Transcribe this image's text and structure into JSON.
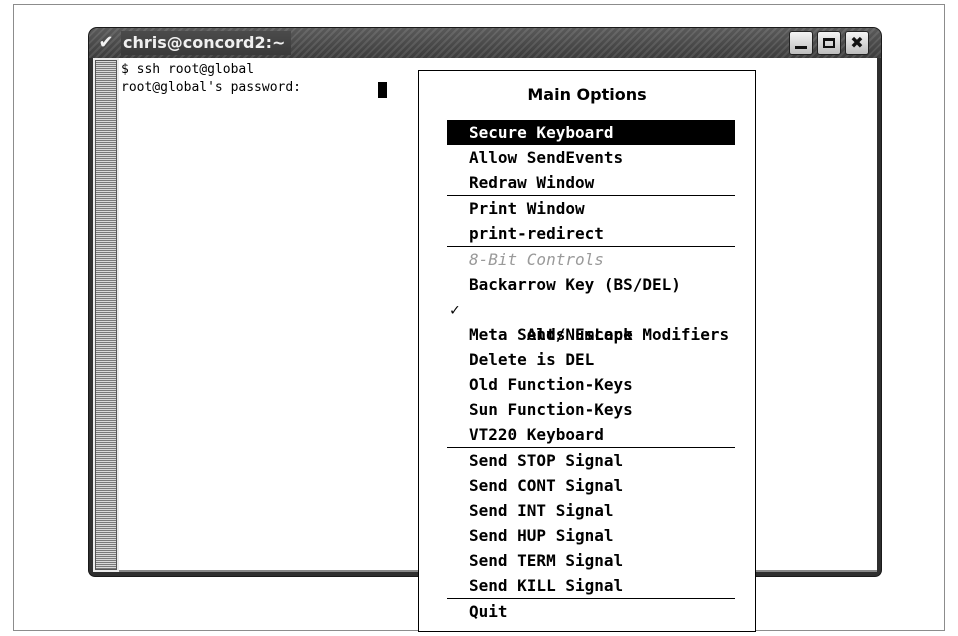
{
  "window": {
    "title": "chris@concord2:~",
    "menu_glyph": "✔",
    "minimize_label": "",
    "close_label": "✖"
  },
  "terminal": {
    "lines": [
      "$ ssh root@global",
      "root@global's password: "
    ]
  },
  "popup": {
    "title": "Main Options",
    "check_glyph": "✓",
    "items": [
      {
        "label": "Secure Keyboard",
        "state": "selected"
      },
      {
        "label": "Allow SendEvents"
      },
      {
        "label": "Redraw Window"
      },
      {
        "label": "Print Window"
      },
      {
        "label": "print-redirect"
      },
      {
        "label": "8-Bit Controls",
        "state": "disabled"
      },
      {
        "label": "Backarrow Key (BS/DEL)"
      },
      {
        "label": "Alt/NumLock Modifiers",
        "checked": true
      },
      {
        "label": "Meta Sends Escape"
      },
      {
        "label": "Delete is DEL"
      },
      {
        "label": "Old Function-Keys"
      },
      {
        "label": "Sun Function-Keys"
      },
      {
        "label": "VT220 Keyboard"
      },
      {
        "label": "Send STOP Signal"
      },
      {
        "label": "Send CONT Signal"
      },
      {
        "label": "Send INT Signal"
      },
      {
        "label": "Send HUP Signal"
      },
      {
        "label": "Send TERM Signal"
      },
      {
        "label": "Send KILL Signal"
      },
      {
        "label": "Quit"
      }
    ]
  }
}
